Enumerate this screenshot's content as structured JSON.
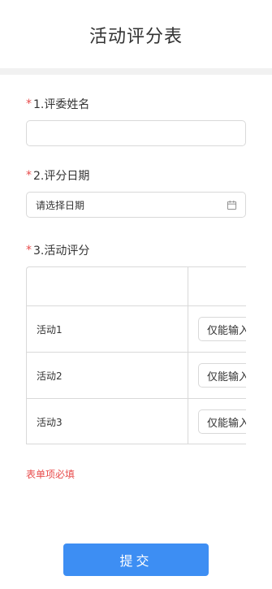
{
  "page": {
    "title": "活动评分表"
  },
  "questions": {
    "q1": {
      "marker": "*",
      "label": "1.评委姓名",
      "value": ""
    },
    "q2": {
      "marker": "*",
      "label": "2.评分日期",
      "placeholder": "请选择日期",
      "icon": "calendar-icon"
    },
    "q3": {
      "marker": "*",
      "label": "3.活动评分",
      "rows": [
        {
          "name": "活动1",
          "placeholder": "仅能输入"
        },
        {
          "name": "活动2",
          "placeholder": "仅能输入"
        },
        {
          "name": "活动3",
          "placeholder": "仅能输入"
        }
      ]
    }
  },
  "validation": {
    "error": "表单项必填",
    "color": "#e84c4c"
  },
  "submit": {
    "label": "提交",
    "color": "#3d8ef3"
  }
}
